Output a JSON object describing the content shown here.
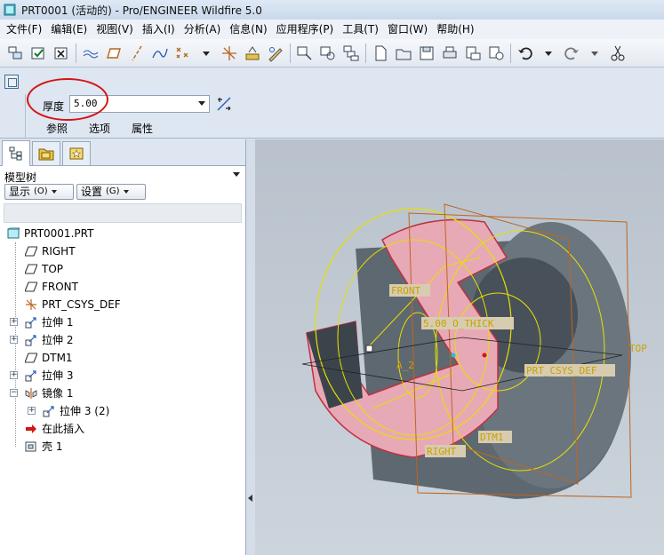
{
  "window": {
    "title": "PRT0001 (活动的) - Pro/ENGINEER Wildfire 5.0"
  },
  "menu": [
    "文件(F)",
    "编辑(E)",
    "视图(V)",
    "插入(I)",
    "分析(A)",
    "信息(N)",
    "应用程序(P)",
    "工具(T)",
    "窗口(W)",
    "帮助(H)"
  ],
  "toolbar": {
    "icons": [
      "layer-icon",
      "regenerate-icon",
      "close-window-icon",
      "datum-plane-display-icon",
      "datum-axis-display-icon",
      "datum-point-display-icon",
      "csys-display-icon",
      "sketch-icon",
      "orient-icon",
      "new-icon",
      "open-icon",
      "save-icon",
      "print-icon",
      "email-icon",
      "undo-icon",
      "redo-icon",
      "cut-icon"
    ]
  },
  "dashboard": {
    "thickness_label": "厚度",
    "thickness_value": "5.00",
    "tabs": [
      "参照",
      "选项",
      "属性"
    ]
  },
  "left_panel": {
    "header": "模型树",
    "show_button": "显示",
    "show_shortcut": "(O)",
    "settings_button": "设置",
    "settings_shortcut": "(G)",
    "tree": [
      {
        "label": "PRT0001.PRT",
        "icon": "part-icon",
        "indent": 0,
        "expandable": false
      },
      {
        "label": "RIGHT",
        "icon": "datum-plane-icon",
        "indent": 1,
        "expandable": false
      },
      {
        "label": "TOP",
        "icon": "datum-plane-icon",
        "indent": 1,
        "expandable": false
      },
      {
        "label": "FRONT",
        "icon": "datum-plane-icon",
        "indent": 1,
        "expandable": false
      },
      {
        "label": "PRT_CSYS_DEF",
        "icon": "csys-icon",
        "indent": 1,
        "expandable": false
      },
      {
        "label": "拉伸 1",
        "icon": "extrude-icon",
        "indent": 1,
        "expandable": true
      },
      {
        "label": "拉伸 2",
        "icon": "extrude-icon",
        "indent": 1,
        "expandable": true
      },
      {
        "label": "DTM1",
        "icon": "datum-plane-icon",
        "indent": 1,
        "expandable": false
      },
      {
        "label": "拉伸 3",
        "icon": "extrude-icon",
        "indent": 1,
        "expandable": true
      },
      {
        "label": "镜像 1",
        "icon": "mirror-icon",
        "indent": 1,
        "expandable": true,
        "expanded": true
      },
      {
        "label": "拉伸 3 (2)",
        "icon": "extrude-icon",
        "indent": 2,
        "expandable": true
      },
      {
        "label": "在此插入",
        "icon": "insert-here-arrow-icon",
        "indent": 1,
        "expandable": false
      },
      {
        "label": "壳 1",
        "icon": "shell-icon",
        "indent": 1,
        "expandable": false
      }
    ]
  },
  "graphics": {
    "labels": {
      "front": "FRONT",
      "thick": "5.00 O_THICK",
      "top": "TOP",
      "csys": "PRT_CSYS_DEF",
      "axis": "A_2",
      "dtm1": "DTM1",
      "right": "RIGHT"
    },
    "colors": {
      "highlight": "#e8a9b6",
      "datum": "#c9a200",
      "plane": "#b5651d",
      "body": "#5f6971"
    }
  }
}
